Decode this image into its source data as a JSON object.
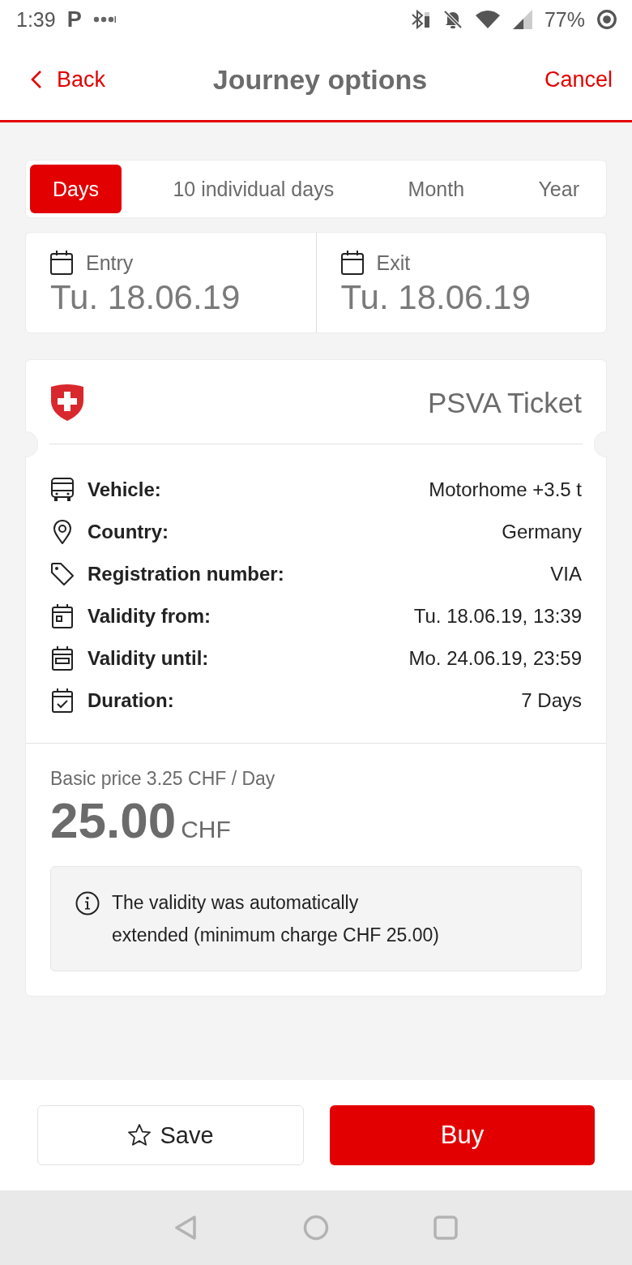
{
  "status_bar": {
    "time": "1:39",
    "app_glyph": "P",
    "battery": "77%"
  },
  "header": {
    "back": "Back",
    "title": "Journey options",
    "cancel": "Cancel"
  },
  "tabs": [
    {
      "label": "Days",
      "selected": true
    },
    {
      "label": "10 individual days",
      "selected": false
    },
    {
      "label": "Month",
      "selected": false
    },
    {
      "label": "Year",
      "selected": false
    }
  ],
  "dates": [
    {
      "label": "Entry",
      "value": "Tu. 18.06.19"
    },
    {
      "label": "Exit",
      "value": "Tu. 18.06.19"
    }
  ],
  "ticket": {
    "title": "PSVA Ticket",
    "details": [
      {
        "kind": "vehicle",
        "label": "Vehicle:",
        "value": "Motorhome +3.5 t"
      },
      {
        "kind": "country",
        "label": "Country:",
        "value": "Germany"
      },
      {
        "kind": "registration",
        "label": "Registration number:",
        "value": "VIA"
      },
      {
        "kind": "valid_from",
        "label": "Validity from:",
        "value": "Tu. 18.06.19, 13:39"
      },
      {
        "kind": "valid_until",
        "label": "Validity until:",
        "value": "Mo. 24.06.19, 23:59"
      },
      {
        "kind": "duration",
        "label": "Duration:",
        "value": "7 Days"
      }
    ],
    "price": {
      "basic": "Basic price 3.25 CHF / Day",
      "amount": "25.00",
      "currency": "CHF"
    },
    "notice": "The validity was automatically\nextended (minimum charge CHF 25.00)"
  },
  "actions": {
    "save": "Save",
    "buy": "Buy"
  }
}
